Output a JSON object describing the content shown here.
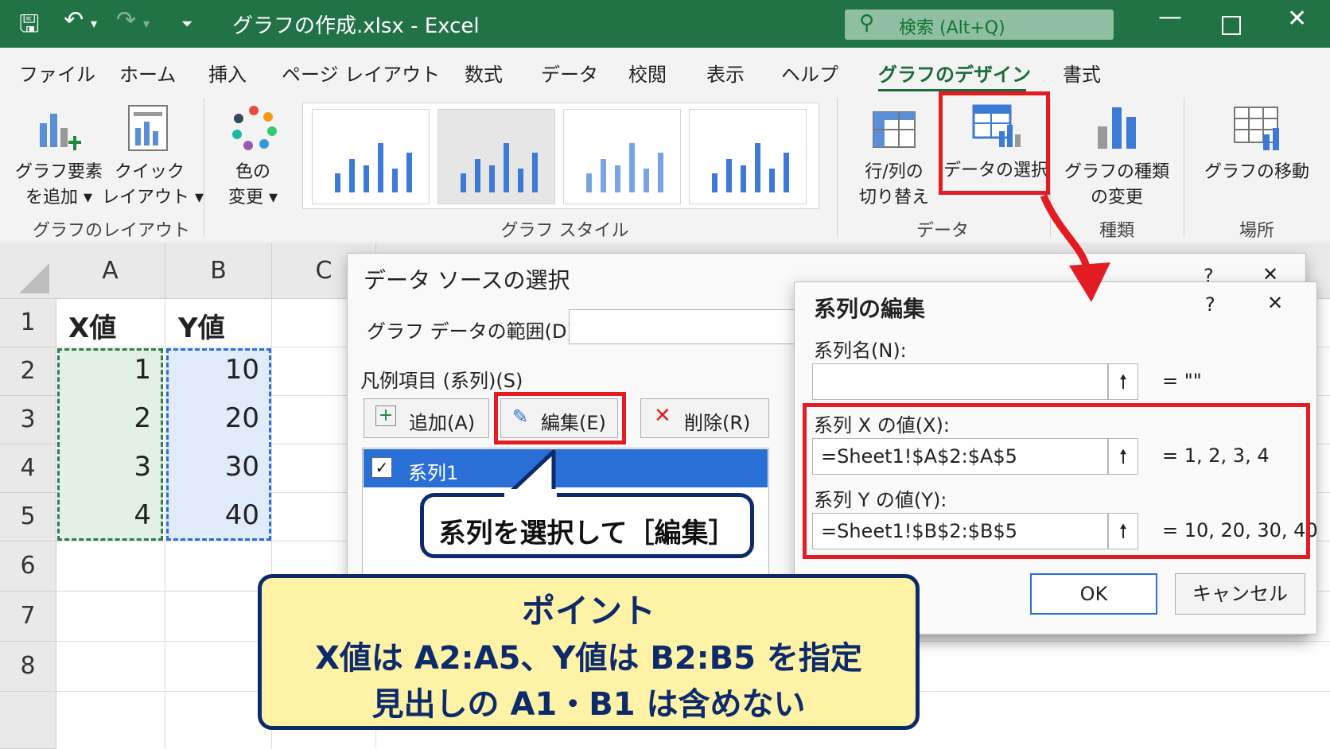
{
  "app": {
    "title": "グラフの作成.xlsx  -  Excel",
    "search_placeholder": "検索 (Alt+Q)"
  },
  "menu": [
    "ファイル",
    "ホーム",
    "挿入",
    "ページ レイアウト",
    "数式",
    "データ",
    "校閲",
    "表示",
    "ヘルプ",
    "グラフのデザイン",
    "書式"
  ],
  "menu_active": "グラフのデザイン",
  "ribbon": {
    "add_element": [
      "グラフ要素",
      "を追加 ▾"
    ],
    "quick_layout": [
      "クイック",
      "レイアウト ▾"
    ],
    "change_color": [
      "色の",
      "変更 ▾"
    ],
    "group_layout": "グラフのレイアウト",
    "group_styles": "グラフ スタイル",
    "switch_row_col": [
      "行/列の",
      "切り替え"
    ],
    "select_data": "データの選択",
    "group_data": "データ",
    "change_type": [
      "グラフの種類",
      "の変更"
    ],
    "group_type": "種類",
    "move_chart": "グラフの移動",
    "group_location": "場所"
  },
  "sheet": {
    "columns": [
      "A",
      "B",
      "C"
    ],
    "rows": [
      "1",
      "2",
      "3",
      "4",
      "5",
      "6",
      "7",
      "8"
    ],
    "header_a": "X値",
    "header_b": "Y値",
    "x_values": [
      "1",
      "2",
      "3",
      "4"
    ],
    "y_values": [
      "10",
      "20",
      "30",
      "40"
    ]
  },
  "data_source_dialog": {
    "title": "データ ソースの選択",
    "help": "?",
    "close": "✕",
    "range_label": "グラフ データの範囲(D):",
    "legend_label": "凡例項目 (系列)(S)",
    "add_button": "追加(A)",
    "edit_button": "編集(E)",
    "delete_button": "削除(R)",
    "series_item": "系列1"
  },
  "series_dialog": {
    "title": "系列の編集",
    "help": "?",
    "close": "✕",
    "name_label": "系列名(N):",
    "name_value": "",
    "name_preview": "= \"\"",
    "x_label": "系列 X の値(X):",
    "x_value": "=Sheet1!$A$2:$A$5",
    "x_preview": "= 1, 2, 3, 4",
    "y_label": "系列 Y の値(Y):",
    "y_value": "=Sheet1!$B$2:$B$5",
    "y_preview": "= 10, 20, 30, 40",
    "ok_button": "OK",
    "cancel_button": "キャンセル"
  },
  "callouts": {
    "edit_hint": "系列を選択して［編集］",
    "point_title": "ポイント",
    "point_line1": "X値は A2:A5、Y値は B2:B5 を指定",
    "point_line2": "見出しの A1・B1 は含めない"
  },
  "colors": {
    "excel_green": "#217346",
    "highlight_red": "#e31b23",
    "callout_fill": "#fdf2a6",
    "callout_border": "#0d2a6b",
    "selection_blue": "#2a6fd6"
  }
}
